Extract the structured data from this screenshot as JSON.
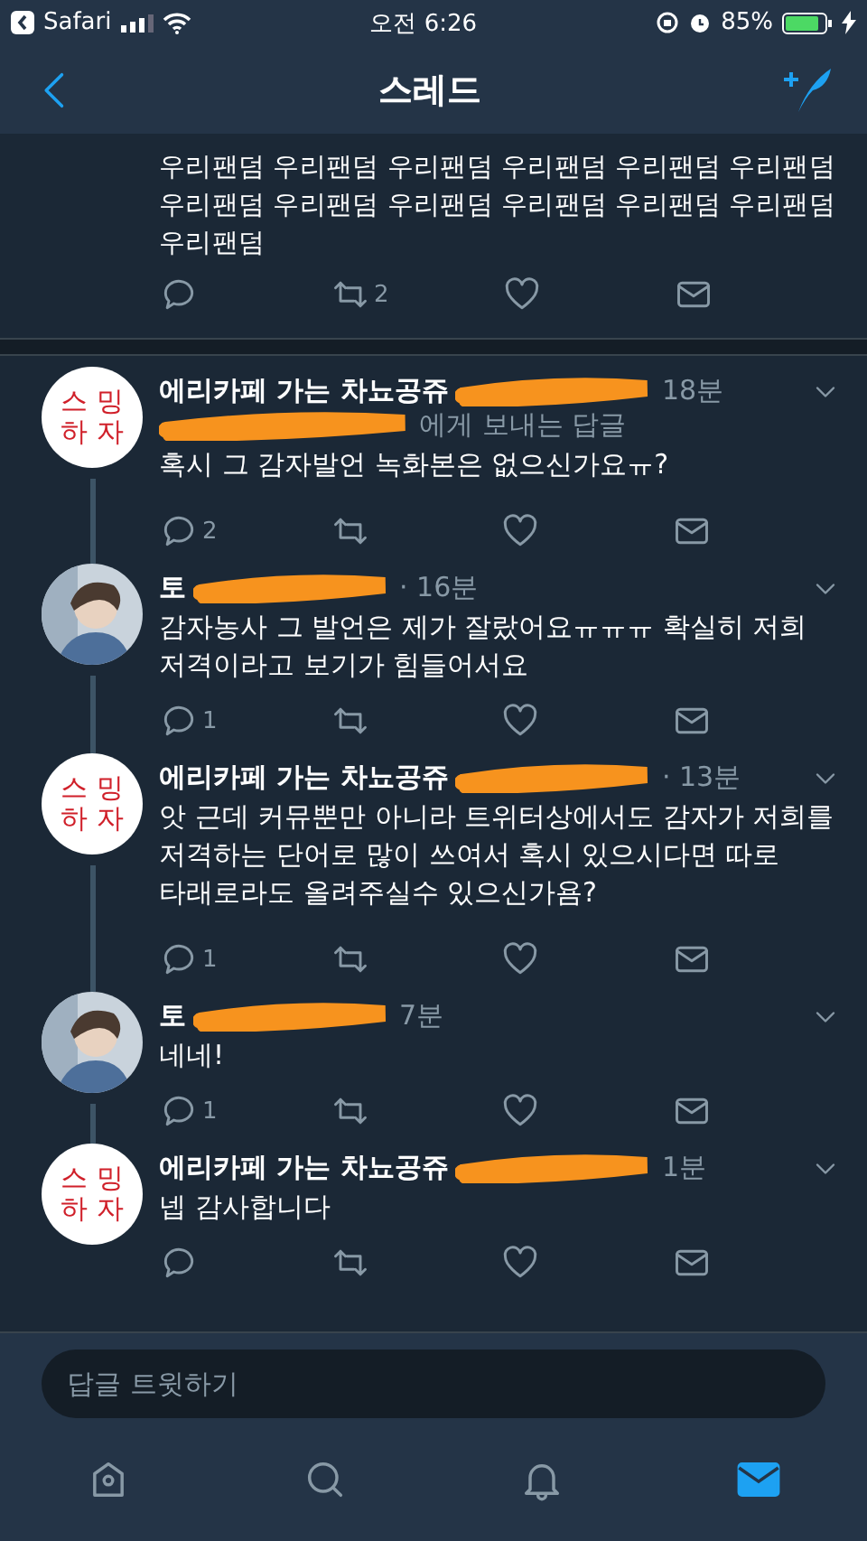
{
  "status_bar": {
    "back_app": "Safari",
    "time": "오전 6:26",
    "battery": "85%"
  },
  "nav": {
    "title": "스레드"
  },
  "top_tweet": {
    "text": "우리팬덤 우리팬덤 우리팬덤 우리팬덤 우리팬덤 우리팬덤 우리팬덤 우리팬덤 우리팬덤 우리팬덤 우리팬덤 우리팬덤 우리팬덤",
    "retweet_count": "2"
  },
  "tweets": [
    {
      "avatar": {
        "kind": "text",
        "lines": [
          "스 밍",
          "하 자"
        ]
      },
      "name": "에리카페 가는 차뇨공쥬",
      "time": "18분",
      "reply_to": "에게 보내는 답글",
      "text": "혹시 그 감자발언 녹화본은 없으신가요ㅠ?",
      "reply_count": "2"
    },
    {
      "name": "토",
      "time": "· 16분",
      "text": "감자농사 그 발언은 제가 잘랐어요ㅠㅠㅠ 확실히 저희 저격이라고 보기가 힘들어서요",
      "reply_count": "1"
    },
    {
      "avatar": {
        "kind": "text",
        "lines": [
          "스 밍",
          "하 자"
        ]
      },
      "name": "에리카페 가는 차뇨공쥬",
      "time": "· 13분",
      "text": "앗 근데 커뮤뿐만 아니라 트위터상에서도 감자가 저희를 저격하는 단어로 많이 쓰여서 혹시 있으시다면 따로 타래로라도 올려주실수 있으신가욤?",
      "reply_count": "1"
    },
    {
      "name": "토",
      "time": "7분",
      "text": "네네!",
      "reply_count": "1"
    },
    {
      "avatar": {
        "kind": "text",
        "lines": [
          "스 밍",
          "하 자"
        ]
      },
      "name": "에리카페 가는 차뇨공쥬",
      "time": "1분",
      "text": "넵 감사합니다"
    }
  ],
  "composer": {
    "placeholder": "답글 트윗하기"
  },
  "tab_bar": [
    {
      "selected": false
    },
    {
      "selected": false
    },
    {
      "selected": false
    },
    {
      "selected": true
    }
  ]
}
